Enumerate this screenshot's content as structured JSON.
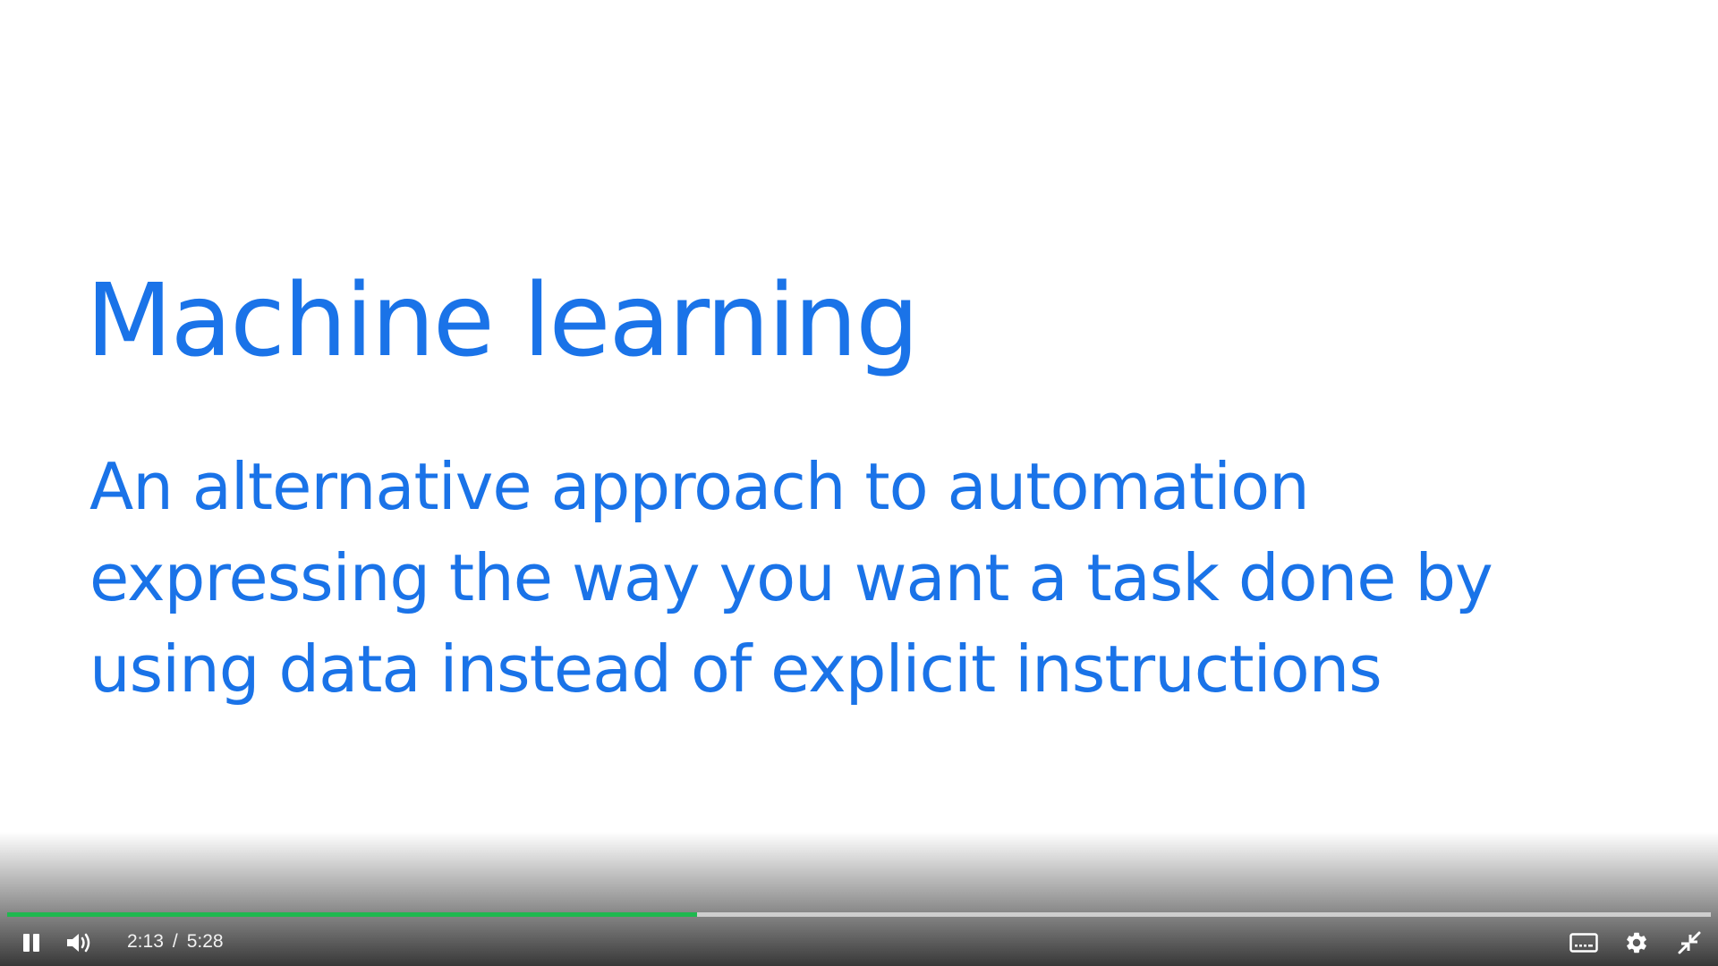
{
  "slide": {
    "title": "Machine learning",
    "body_lines": [
      "An alternative approach to automation",
      "expressing the way you want a task done by",
      "using data instead of explicit instructions"
    ],
    "text_color": "#1a73e8"
  },
  "player": {
    "current_time": "2:13",
    "separator": "/",
    "duration": "5:28",
    "progress_fraction": 0.405,
    "progress_color": "#1fb84f",
    "icons": {
      "play_pause": "pause-icon",
      "volume": "volume-icon",
      "captions": "captions-icon",
      "settings": "gear-icon",
      "fullscreen": "exit-fullscreen-icon"
    }
  }
}
